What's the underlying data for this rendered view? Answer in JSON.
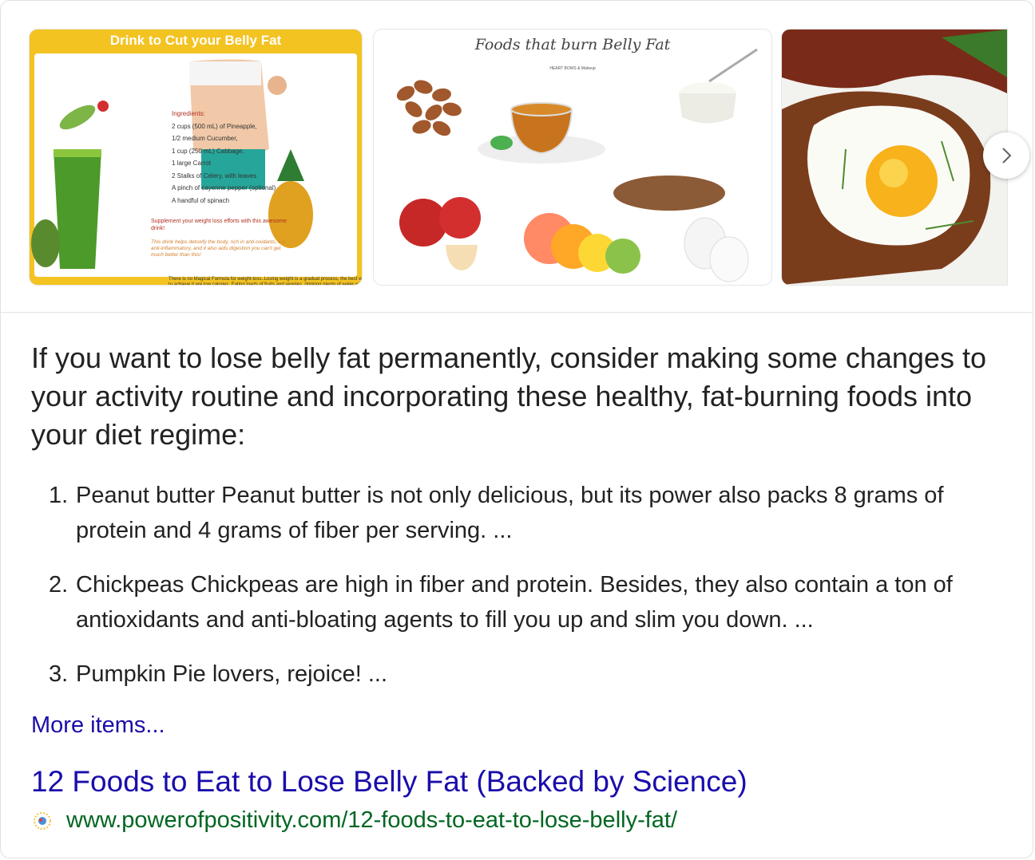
{
  "images": [
    {
      "title": "Drink to Cut your Belly Fat",
      "ingredients_heading": "Ingredients:",
      "ingredients": [
        "2 cups (500 mL) of Pineapple,",
        "1/2 medium Cucumber,",
        "1 cup (250 mL) Cabbage,",
        "1 large Carrot",
        "2 Stalks of Celery, with leaves",
        "A pinch of cayenne pepper (optional)",
        "A handful of spinach"
      ],
      "supplement": "Supplement your weight loss efforts with this awesome drink!",
      "note": "This drink helps detoxify the body, rich in anti-oxidants, it is anti-inflammatory, and it also aids digestion you can't get much better than this!",
      "footer": "There is no Magical Formula for weight-loss..Losing weight is a gradual process, the best way to achieve it are low calories, Eating loads of fruits and veggies, drinking plenty of water with regular exercise."
    },
    {
      "title": "Foods that burn Belly Fat",
      "subtitle": "HEART BOWS & Makeup"
    },
    {}
  ],
  "next_icon": "chevron-right-icon",
  "intro": "If you want to lose belly fat permanently, consider making some changes to your activity routine and incorporating these healthy, fat-burning foods into your diet regime:",
  "items": [
    {
      "num": "1.",
      "text": "Peanut butter Peanut butter is not only delicious, but its power also packs 8 grams of protein and 4 grams of fiber per serving. ..."
    },
    {
      "num": "2.",
      "text": "Chickpeas Chickpeas are high in fiber and protein. Besides, they also contain a ton of antioxidants and anti-bloating agents to fill you up and slim you down. ..."
    },
    {
      "num": "3.",
      "text": "Pumpkin Pie lovers, rejoice! ..."
    }
  ],
  "more_items": "More items...",
  "result": {
    "title": "12 Foods to Eat to Lose Belly Fat (Backed by Science)",
    "url": "www.powerofpositivity.com/12-foods-to-eat-to-lose-belly-fat/",
    "favicon": "site-favicon-icon"
  },
  "colors": {
    "link": "#1a0dab",
    "url": "#006621",
    "text": "#222222"
  }
}
